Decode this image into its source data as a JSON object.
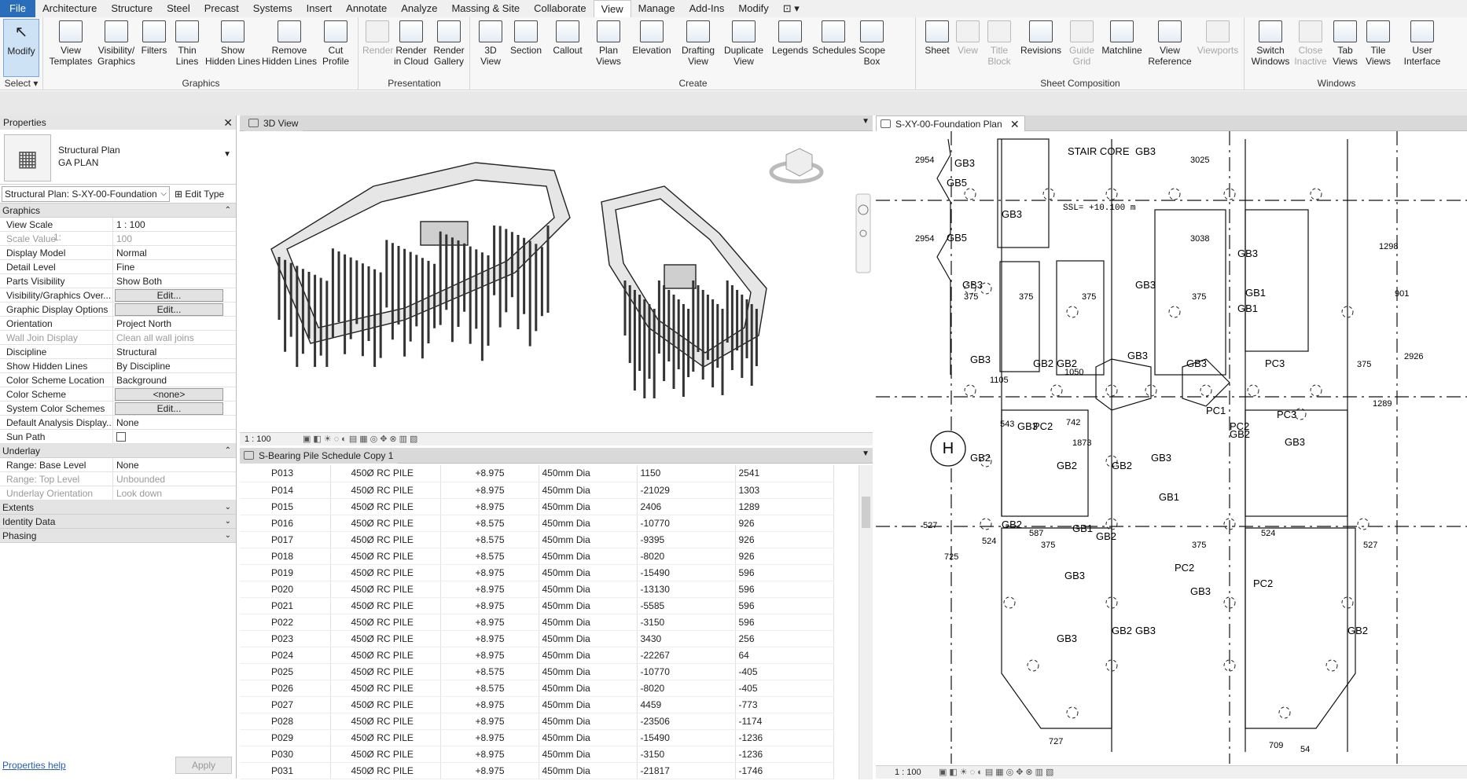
{
  "menubar": {
    "items": [
      "File",
      "Architecture",
      "Structure",
      "Steel",
      "Precast",
      "Systems",
      "Insert",
      "Annotate",
      "Analyze",
      "Massing & Site",
      "Collaborate",
      "View",
      "Manage",
      "Add-Ins",
      "Modify"
    ],
    "active": "View"
  },
  "ribbon": {
    "select": {
      "modify": "Modify",
      "group": "Select"
    },
    "graphics": {
      "label": "Graphics",
      "buttons": [
        [
          "View",
          "Templates"
        ],
        [
          "Visibility/",
          "Graphics"
        ],
        [
          "Filters",
          ""
        ],
        [
          "Thin",
          "Lines"
        ],
        [
          "Show",
          "Hidden Lines"
        ],
        [
          "Remove",
          "Hidden Lines"
        ],
        [
          "Cut",
          "Profile"
        ]
      ]
    },
    "presentation": {
      "label": "Presentation",
      "buttons": [
        [
          "Render",
          ""
        ],
        [
          "Render",
          "in Cloud"
        ],
        [
          "Render",
          "Gallery"
        ]
      ]
    },
    "create": {
      "label": "Create",
      "buttons": [
        [
          "3D",
          "View"
        ],
        [
          "Section",
          ""
        ],
        [
          "Callout",
          ""
        ],
        [
          "Plan",
          "Views"
        ],
        [
          "Elevation",
          ""
        ],
        [
          "Drafting",
          "View"
        ],
        [
          "Duplicate",
          "View"
        ],
        [
          "Legends",
          ""
        ],
        [
          "Schedules",
          ""
        ],
        [
          "Scope",
          "Box"
        ]
      ]
    },
    "sheet": {
      "label": "Sheet Composition",
      "buttons": [
        [
          "Sheet",
          ""
        ],
        [
          "View",
          ""
        ],
        [
          "Title",
          "Block"
        ],
        [
          "Revisions",
          ""
        ],
        [
          "Guide",
          "Grid"
        ],
        [
          "Matchline",
          ""
        ],
        [
          "View",
          "Reference"
        ],
        [
          "Viewports",
          ""
        ]
      ]
    },
    "windows": {
      "label": "Windows",
      "buttons": [
        [
          "Switch",
          "Windows"
        ],
        [
          "Close",
          "Inactive"
        ],
        [
          "Tab",
          "Views"
        ],
        [
          "Tile",
          "Views"
        ],
        [
          "User",
          "Interface"
        ]
      ]
    }
  },
  "properties": {
    "title": "Properties",
    "type_line1": "Structural Plan",
    "type_line2": "GA PLAN",
    "instance": "Structural Plan: S-XY-00-Foundation",
    "edit_type": "Edit Type",
    "groups": {
      "graphics": "Graphics",
      "underlay": "Underlay",
      "extents": "Extents",
      "identity": "Identity Data",
      "phasing": "Phasing"
    },
    "graphics_rows": [
      {
        "k": "View Scale",
        "v": "1 : 100"
      },
      {
        "k": "Scale Value",
        "k2": "1:",
        "v": "100",
        "dim": true
      },
      {
        "k": "Display Model",
        "v": "Normal"
      },
      {
        "k": "Detail Level",
        "v": "Fine"
      },
      {
        "k": "Parts Visibility",
        "v": "Show Both"
      },
      {
        "k": "Visibility/Graphics Over...",
        "v": "Edit...",
        "btn": true
      },
      {
        "k": "Graphic Display Options",
        "v": "Edit...",
        "btn": true
      },
      {
        "k": "Orientation",
        "v": "Project North"
      },
      {
        "k": "Wall Join Display",
        "v": "Clean all wall joins",
        "dim": true
      },
      {
        "k": "Discipline",
        "v": "Structural"
      },
      {
        "k": "Show Hidden Lines",
        "v": "By Discipline"
      },
      {
        "k": "Color Scheme Location",
        "v": "Background"
      },
      {
        "k": "Color Scheme",
        "v": "<none>",
        "btn": true
      },
      {
        "k": "System Color Schemes",
        "v": "Edit...",
        "btn": true
      },
      {
        "k": "Default Analysis Display...",
        "v": "None"
      },
      {
        "k": "Sun Path",
        "v": "",
        "check": true
      }
    ],
    "underlay_rows": [
      {
        "k": "Range: Base Level",
        "v": "None"
      },
      {
        "k": "Range: Top Level",
        "v": "Unbounded",
        "dim": true
      },
      {
        "k": "Underlay Orientation",
        "v": "Look down",
        "dim": true
      }
    ],
    "help": "Properties help",
    "apply": "Apply"
  },
  "view3d": {
    "tab": "3D View",
    "scale": "1 : 100"
  },
  "schedule": {
    "tab": "S-Bearing Pile Schedule Copy 1",
    "rows": [
      [
        "P013",
        "450Ø RC PILE",
        "+8.975",
        "450mm Dia",
        "1150",
        "2541"
      ],
      [
        "P014",
        "450Ø RC PILE",
        "+8.975",
        "450mm Dia",
        "-21029",
        "1303"
      ],
      [
        "P015",
        "450Ø RC PILE",
        "+8.975",
        "450mm Dia",
        "2406",
        "1289"
      ],
      [
        "P016",
        "450Ø RC PILE",
        "+8.575",
        "450mm Dia",
        "-10770",
        "926"
      ],
      [
        "P017",
        "450Ø RC PILE",
        "+8.575",
        "450mm Dia",
        "-9395",
        "926"
      ],
      [
        "P018",
        "450Ø RC PILE",
        "+8.575",
        "450mm Dia",
        "-8020",
        "926"
      ],
      [
        "P019",
        "450Ø RC PILE",
        "+8.975",
        "450mm Dia",
        "-15490",
        "596"
      ],
      [
        "P020",
        "450Ø RC PILE",
        "+8.975",
        "450mm Dia",
        "-13130",
        "596"
      ],
      [
        "P021",
        "450Ø RC PILE",
        "+8.975",
        "450mm Dia",
        "-5585",
        "596"
      ],
      [
        "P022",
        "450Ø RC PILE",
        "+8.975",
        "450mm Dia",
        "-3150",
        "596"
      ],
      [
        "P023",
        "450Ø RC PILE",
        "+8.975",
        "450mm Dia",
        "3430",
        "256"
      ],
      [
        "P024",
        "450Ø RC PILE",
        "+8.975",
        "450mm Dia",
        "-22267",
        "64"
      ],
      [
        "P025",
        "450Ø RC PILE",
        "+8.575",
        "450mm Dia",
        "-10770",
        "-405"
      ],
      [
        "P026",
        "450Ø RC PILE",
        "+8.575",
        "450mm Dia",
        "-8020",
        "-405"
      ],
      [
        "P027",
        "450Ø RC PILE",
        "+8.975",
        "450mm Dia",
        "4459",
        "-773"
      ],
      [
        "P028",
        "450Ø RC PILE",
        "+8.975",
        "450mm Dia",
        "-23506",
        "-1174"
      ],
      [
        "P029",
        "450Ø RC PILE",
        "+8.975",
        "450mm Dia",
        "-15490",
        "-1236"
      ],
      [
        "P030",
        "450Ø RC PILE",
        "+8.975",
        "450mm Dia",
        "-3150",
        "-1236"
      ],
      [
        "P031",
        "450Ø RC PILE",
        "+8.975",
        "450mm Dia",
        "-21817",
        "-1746"
      ]
    ]
  },
  "plan": {
    "tab": "S-XY-00-Foundation Plan",
    "scale": "1 : 100",
    "stair": "STAIR CORE",
    "ssl": "SSL= +10.100 m",
    "grid_h": "H",
    "labels": [
      "GB3",
      "GB5",
      "GB3",
      "GB5",
      "GB3",
      "GB3",
      "GB3",
      "GB3",
      "GB1",
      "GB1",
      "PC1",
      "GB3",
      "GB3",
      "GB2",
      "GB2",
      "GB3",
      "PC3",
      "PC3",
      "GB2",
      "GB3",
      "PC2",
      "GB2",
      "PC2",
      "GB3",
      "GB2",
      "GB2",
      "GB3",
      "GB1",
      "GB2",
      "GB2",
      "GB1",
      "GB3",
      "PC2",
      "PC2",
      "GB3",
      "GB3",
      "GB2",
      "GB3",
      "GB2"
    ],
    "dims": [
      "2954",
      "2954",
      "3025",
      "3038",
      "1298",
      "375",
      "375",
      "375",
      "375",
      "901",
      "2926",
      "375",
      "1105",
      "1050",
      "1289",
      "543",
      "742",
      "1873",
      "527",
      "524",
      "587",
      "375",
      "375",
      "524",
      "527",
      "725",
      "727",
      "709",
      "54"
    ]
  }
}
